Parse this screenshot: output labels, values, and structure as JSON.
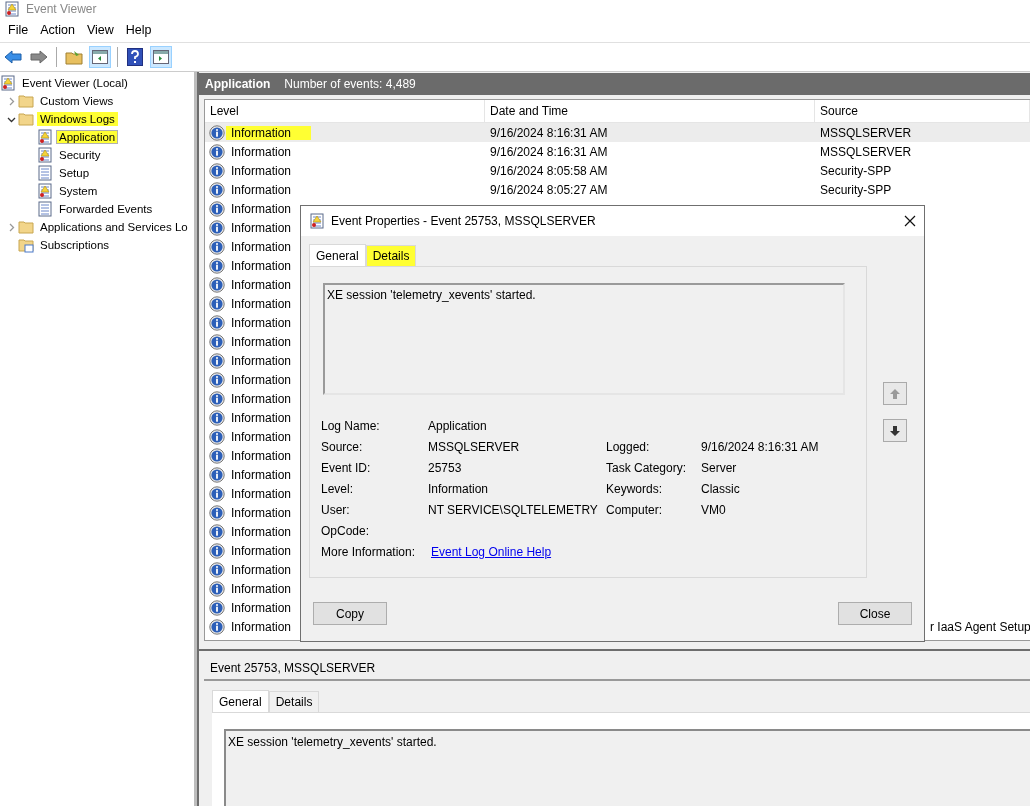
{
  "window": {
    "title": "Event Viewer"
  },
  "menu": [
    "File",
    "Action",
    "View",
    "Help"
  ],
  "tree": [
    {
      "label": "Event Viewer (Local)",
      "kind": "root",
      "selected": false,
      "highlighted": false,
      "children": [
        {
          "label": "Custom Views",
          "kind": "folder",
          "expanded": false,
          "selected": false,
          "highlighted": false
        },
        {
          "label": "Windows Logs",
          "kind": "folder",
          "expanded": true,
          "selected": false,
          "highlighted": true,
          "children": [
            {
              "label": "Application",
              "kind": "log",
              "selected": true,
              "highlighted": true
            },
            {
              "label": "Security",
              "kind": "log",
              "selected": false,
              "highlighted": false
            },
            {
              "label": "Setup",
              "kind": "plainlog",
              "selected": false,
              "highlighted": false
            },
            {
              "label": "System",
              "kind": "log",
              "selected": false,
              "highlighted": false
            },
            {
              "label": "Forwarded Events",
              "kind": "plainlog",
              "selected": false,
              "highlighted": false
            }
          ]
        },
        {
          "label": "Applications and Services Lo",
          "kind": "folder",
          "expanded": false,
          "selected": false,
          "highlighted": false
        },
        {
          "label": "Subscriptions",
          "kind": "subscriptions",
          "selected": false,
          "highlighted": false
        }
      ]
    }
  ],
  "pane": {
    "title": "Application",
    "count": "Number of events: 4,489"
  },
  "table": {
    "columns": [
      "Level",
      "Date and Time",
      "Source"
    ],
    "rows": [
      {
        "level": "Information",
        "date": "9/16/2024 8:16:31 AM",
        "source": "MSSQLSERVER",
        "selected": true,
        "highlighted": true
      },
      {
        "level": "Information",
        "date": "9/16/2024 8:16:31 AM",
        "source": "MSSQLSERVER",
        "selected": false,
        "highlighted": false
      },
      {
        "level": "Information",
        "date": "9/16/2024 8:05:58 AM",
        "source": "Security-SPP",
        "selected": false,
        "highlighted": false
      },
      {
        "level": "Information",
        "date": "9/16/2024 8:05:27 AM",
        "source": "Security-SPP",
        "selected": false,
        "highlighted": false
      },
      {
        "level": "Information",
        "selected": false,
        "highlighted": false
      },
      {
        "level": "Information",
        "selected": false,
        "highlighted": false
      },
      {
        "level": "Information",
        "selected": false,
        "highlighted": false
      },
      {
        "level": "Information",
        "selected": false,
        "highlighted": false
      },
      {
        "level": "Information",
        "selected": false,
        "highlighted": false
      },
      {
        "level": "Information",
        "selected": false,
        "highlighted": false
      },
      {
        "level": "Information",
        "selected": false,
        "highlighted": false
      },
      {
        "level": "Information",
        "selected": false,
        "highlighted": false
      },
      {
        "level": "Information",
        "selected": false,
        "highlighted": false
      },
      {
        "level": "Information",
        "selected": false,
        "highlighted": false
      },
      {
        "level": "Information",
        "selected": false,
        "highlighted": false
      },
      {
        "level": "Information",
        "selected": false,
        "highlighted": false
      },
      {
        "level": "Information",
        "selected": false,
        "highlighted": false
      },
      {
        "level": "Information",
        "selected": false,
        "highlighted": false
      },
      {
        "level": "Information",
        "selected": false,
        "highlighted": false
      },
      {
        "level": "Information",
        "selected": false,
        "highlighted": false
      },
      {
        "level": "Information",
        "selected": false,
        "highlighted": false
      },
      {
        "level": "Information",
        "selected": false,
        "highlighted": false
      },
      {
        "level": "Information",
        "selected": false,
        "highlighted": false
      },
      {
        "level": "Information",
        "selected": false,
        "highlighted": false
      },
      {
        "level": "Information",
        "selected": false,
        "highlighted": false
      },
      {
        "level": "Information",
        "selected": false,
        "highlighted": false
      },
      {
        "level": "Information",
        "source": "r IaaS Agent Setup",
        "selected": false,
        "highlighted": false
      }
    ]
  },
  "dialog": {
    "title": "Event Properties - Event 25753, MSSQLSERVER",
    "tabs": [
      {
        "label": "General",
        "selected": true,
        "highlighted": false
      },
      {
        "label": "Details",
        "selected": false,
        "highlighted": true
      }
    ],
    "message": "XE session 'telemetry_xevents' started.",
    "fields": [
      {
        "left": {
          "label": "Log Name:",
          "value": "Application"
        }
      },
      {
        "left": {
          "label": "Source:",
          "value": "MSSQLSERVER"
        },
        "right": {
          "label": "Logged:",
          "value": "9/16/2024 8:16:31 AM"
        }
      },
      {
        "left": {
          "label": "Event ID:",
          "value": "25753"
        },
        "right": {
          "label": "Task Category:",
          "value": "Server"
        }
      },
      {
        "left": {
          "label": "Level:",
          "value": "Information"
        },
        "right": {
          "label": "Keywords:",
          "value": "Classic"
        }
      },
      {
        "left": {
          "label": "User:",
          "value": "NT SERVICE\\SQLTELEMETRY"
        },
        "right": {
          "label": "Computer:",
          "value": "VM0"
        }
      },
      {
        "left": {
          "label": "OpCode:"
        }
      },
      {
        "left": {
          "label": "More Information:",
          "value": "Event Log Online Help",
          "kind": "link"
        }
      }
    ],
    "buttons": [
      "Copy",
      "Close"
    ]
  },
  "preview": {
    "title": "Event 25753, MSSQLSERVER",
    "tabs": [
      {
        "label": "General",
        "selected": true
      },
      {
        "label": "Details",
        "selected": false
      }
    ],
    "message": "XE session 'telemetry_xevents' started."
  }
}
